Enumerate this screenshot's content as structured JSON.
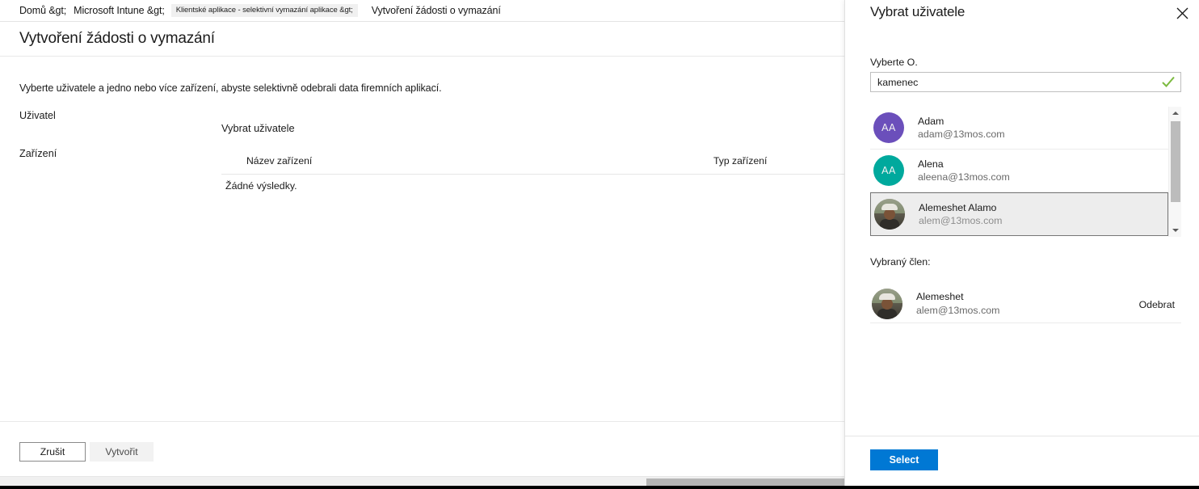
{
  "breadcrumb": {
    "home": "Domů &gt;",
    "intune": "Microsoft Intune &gt;",
    "apps": "Klientské aplikace - selektivní vymazání aplikace &gt;",
    "current": "Vytvoření žádosti o vymazání"
  },
  "page": {
    "title": "Vytvoření žádosti o vymazání",
    "description": "Vyberte uživatele a jedno nebo více zařízení, abyste selektivně odebrali data firemních aplikací.",
    "user_label": "Uživatel",
    "device_label": "Zařízení",
    "select_user_link": "Vybrat uživatele"
  },
  "device_table": {
    "columns": [
      "Název zařízení",
      "Typ zařízení"
    ],
    "empty_text": "Žádné výsledky."
  },
  "footer": {
    "cancel_label": "Zrušit",
    "create_label": "Vytvořit"
  },
  "side_pane": {
    "title": "Vybrat uživatele",
    "close_icon": "close-icon",
    "search": {
      "label": "Vyberte O.",
      "value": "kamenec",
      "placeholder": "",
      "valid_icon": "checkmark-icon",
      "valid_color": "#7DBB42"
    },
    "results": [
      {
        "name": "Adam",
        "email": "adam@13mos.com",
        "avatar_type": "initials",
        "initials": "AA",
        "avatar_color": "#6B4FBB",
        "selected": false
      },
      {
        "name": "Alena",
        "email": "aleena@13mos.com",
        "avatar_type": "initials",
        "initials": "AA",
        "avatar_color": "#00A99D",
        "selected": false
      },
      {
        "name": "Alemeshet Alamo",
        "email": "alem@13mos.com",
        "avatar_type": "photo",
        "initials": "",
        "avatar_color": "#8A8474",
        "selected": true
      }
    ],
    "selected_member": {
      "label": "Vybraný člen:",
      "name": "Alemeshet",
      "email": "alem@13mos.com",
      "avatar_type": "photo",
      "remove_label": "Odebrat"
    },
    "submit_label": "Select",
    "accent_color": "#0078D4"
  }
}
